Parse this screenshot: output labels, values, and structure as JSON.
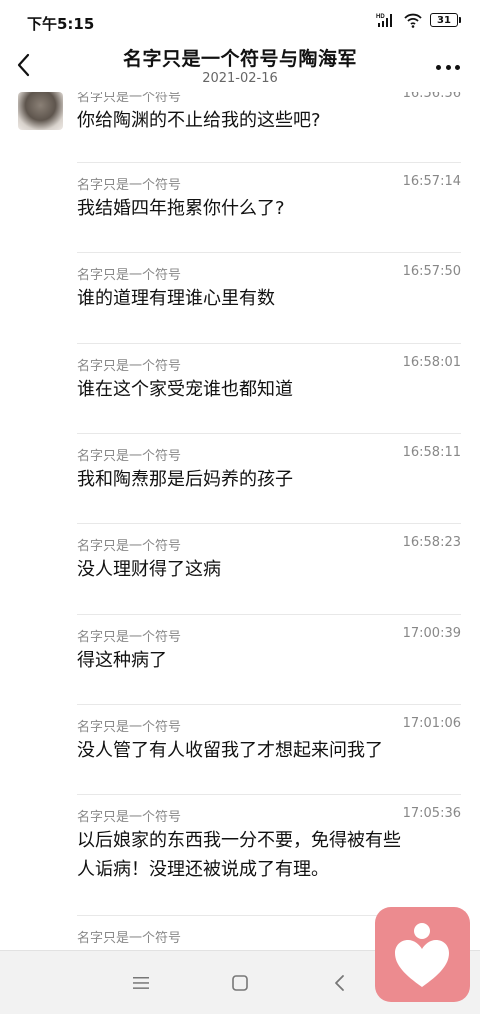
{
  "status_bar": {
    "time": "下午5:15",
    "battery": "31",
    "signal_label": "HD"
  },
  "header": {
    "title": "名字只是一个符号与陶海军",
    "subtitle": "2021-02-16"
  },
  "messages": [
    {
      "name": "名字只是一个符号",
      "time": "16:56:56",
      "lines": [
        "你给陶渊的不止给我的这些吧?"
      ]
    },
    {
      "name": "名字只是一个符号",
      "time": "16:57:14",
      "lines": [
        "我结婚四年拖累你什么了?"
      ]
    },
    {
      "name": "名字只是一个符号",
      "time": "16:57:50",
      "lines": [
        "谁的道理有理谁心里有数"
      ]
    },
    {
      "name": "名字只是一个符号",
      "time": "16:58:01",
      "lines": [
        "谁在这个家受宠谁也都知道"
      ]
    },
    {
      "name": "名字只是一个符号",
      "time": "16:58:11",
      "lines": [
        "我和陶焘那是后妈养的孩子"
      ]
    },
    {
      "name": "名字只是一个符号",
      "time": "16:58:23",
      "lines": [
        "没人理财得了这病"
      ]
    },
    {
      "name": "名字只是一个符号",
      "time": "17:00:39",
      "lines": [
        "得这种病了"
      ]
    },
    {
      "name": "名字只是一个符号",
      "time": "17:01:06",
      "lines": [
        "没人管了有人收留我了才想起来问我了"
      ]
    },
    {
      "name": "名字只是一个符号",
      "time": "17:05:36",
      "lines": [
        "以后娘家的东西我一分不要，免得被有些",
        "人诟病！没理还被说成了有理。"
      ]
    },
    {
      "name": "名字只是一个符号",
      "time": "",
      "lines": []
    }
  ],
  "colors": {
    "badge": "#ec8b8f",
    "meta_text": "#888888",
    "divider": "#e8e8e8"
  },
  "icons": {
    "back": "chevron-left-icon",
    "more": "more-dots-icon",
    "nav_menu": "menu-icon",
    "nav_home": "home-square-icon",
    "nav_back": "back-triangle-icon",
    "badge": "heart-person-icon"
  }
}
